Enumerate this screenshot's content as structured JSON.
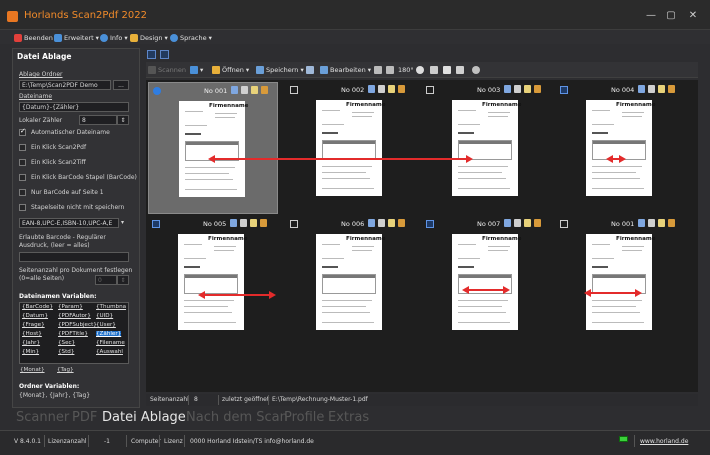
{
  "window": {
    "title": "Horlands Scan2Pdf 2022",
    "buttons": {
      "minimize": "—",
      "maximize": "▢",
      "close": "✕"
    }
  },
  "menu": {
    "items": [
      {
        "label": "Beenden",
        "icon": "exit-icon",
        "color": "#e2403b"
      },
      {
        "label": "Erweitert",
        "icon": "tools-icon",
        "color": "#4a90d9"
      },
      {
        "label": "Info",
        "icon": "info-icon",
        "color": "#4a90d9"
      },
      {
        "label": "Design",
        "icon": "brush-icon",
        "color": "#e8b03a"
      },
      {
        "label": "Sprache",
        "icon": "globe-icon",
        "color": "#4a90d9"
      }
    ],
    "dropdown_glyph": "▾"
  },
  "left_panel": {
    "title": "Datei Ablage",
    "folder_label": "Ablage Ordner",
    "folder_value": "E:\\Temp\\Scan2PDF Demo",
    "browse_label": "...",
    "filename_label": "Dateiname",
    "filename_value": "{Datum}-{Zähler}",
    "counter_label": "Lokaler Zähler",
    "counter_value": "8",
    "options": [
      {
        "label": "Automatischer Dateiname",
        "checked": true
      },
      {
        "label": "Ein Klick Scan2Pdf",
        "checked": false
      },
      {
        "label": "Ein Klick Scan2Tiff",
        "checked": false
      },
      {
        "label": "Ein Klick BarCode Stapel (BarCode)",
        "checked": false
      },
      {
        "label": "Nur BarCode auf Seite 1",
        "checked": false
      },
      {
        "label": "Stapelseite nicht mit speichern",
        "checked": false
      }
    ],
    "barcode_select": "EAN-8,UPC-E,ISBN-10,UPC-A,E",
    "barcode_regex_label_1": "Erlaubte Barcode - Regulärer",
    "barcode_regex_label_2": "Ausdruck, (leer = alles)",
    "barcode_regex_value": "",
    "pages_label_1": "Seitenanzahl pro Dokument festlegen",
    "pages_label_2": "(0=alle Seiten)",
    "pages_value": "0",
    "variables_title": "Dateinamen Variablen:",
    "variables": [
      [
        "{BarCode}",
        "{Param}",
        "{Thumbna"
      ],
      [
        "{Datum}",
        "{PDFAutor}",
        "{UID}"
      ],
      [
        "{Frage}",
        "{PDFSubject}",
        "{User}"
      ],
      [
        "{Host}",
        "{PDFTitle}",
        "{Zähler}"
      ],
      [
        "{Jahr}",
        "{Sec}",
        "{Filename"
      ],
      [
        "{Min}",
        "{Std}",
        "{Auswahl"
      ],
      [
        "{Monat}",
        "{Tag}",
        ""
      ]
    ],
    "selected_variable": "{Zähler}",
    "folder_vars_title": "Ordner Variablen:",
    "folder_vars_value": "{Monat}, {Jahr}, {Tag}"
  },
  "toolbar": {
    "scan": "Scannen",
    "open": "Öffnen",
    "save": "Speichern",
    "edit": "Bearbeiten",
    "rotate": "180°"
  },
  "documents": [
    {
      "label": "No 001",
      "brand": "Firmenname",
      "selected": true
    },
    {
      "label": "No 002",
      "brand": "Firmenname",
      "selected": false
    },
    {
      "label": "No 003",
      "brand": "Firmenname",
      "selected": false
    },
    {
      "label": "No 004",
      "brand": "Firmenname",
      "selected": false
    },
    {
      "label": "No 005",
      "brand": "Firmenname",
      "selected": false
    },
    {
      "label": "No 006",
      "brand": "Firmenname",
      "selected": false
    },
    {
      "label": "No 007",
      "brand": "Firmenname",
      "selected": false
    },
    {
      "label": "No 001",
      "brand": "Firmenname",
      "selected": false
    }
  ],
  "info_bar": {
    "pages_label": "Seitenanzahl",
    "pages_value": "8",
    "last_opened_label": "zuletzt geöffnet",
    "last_opened_value": "E:\\Temp\\Rechnung-Muster-1.pdf"
  },
  "tabs": [
    {
      "label": "Scanner",
      "active": false
    },
    {
      "label": "PDF",
      "active": false
    },
    {
      "label": "Datei Ablage",
      "active": true
    },
    {
      "label": "Nach dem Scan",
      "active": false
    },
    {
      "label": "Profile",
      "active": false
    },
    {
      "label": "Extras",
      "active": false
    }
  ],
  "status": {
    "version": "V 8.4.0.1",
    "license_label": "Lizenzanzahl",
    "license_value": "-1",
    "computer_label": "Computer",
    "licence_label": "Lizenz",
    "licence_value": "0000 Horland Idstein/TS info@horland.de",
    "website": "www.horland.de"
  },
  "colors": {
    "accent_orange": "#f08a2a",
    "arrow_red": "#e32b2b",
    "selection_blue": "#1d6fc9"
  }
}
